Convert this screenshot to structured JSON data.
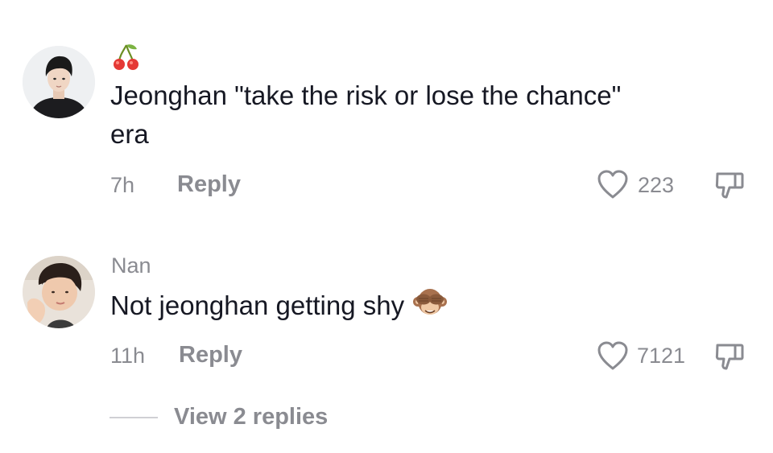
{
  "comments": [
    {
      "username": "",
      "username_icon": "cherries-icon",
      "text": "Jeonghan \"take the risk or lose the chance\"",
      "text_line2": "era",
      "time": "7h",
      "reply_label": "Reply",
      "likes": "223"
    },
    {
      "username": "Nan",
      "text": "Not jeonghan getting shy",
      "emoji": "see-no-evil-monkey-icon",
      "time": "11h",
      "reply_label": "Reply",
      "likes": "7121"
    }
  ],
  "view_replies_label": "View 2 replies",
  "colors": {
    "text_primary": "#161823",
    "text_secondary": "#8a8b91",
    "background": "#ffffff"
  }
}
